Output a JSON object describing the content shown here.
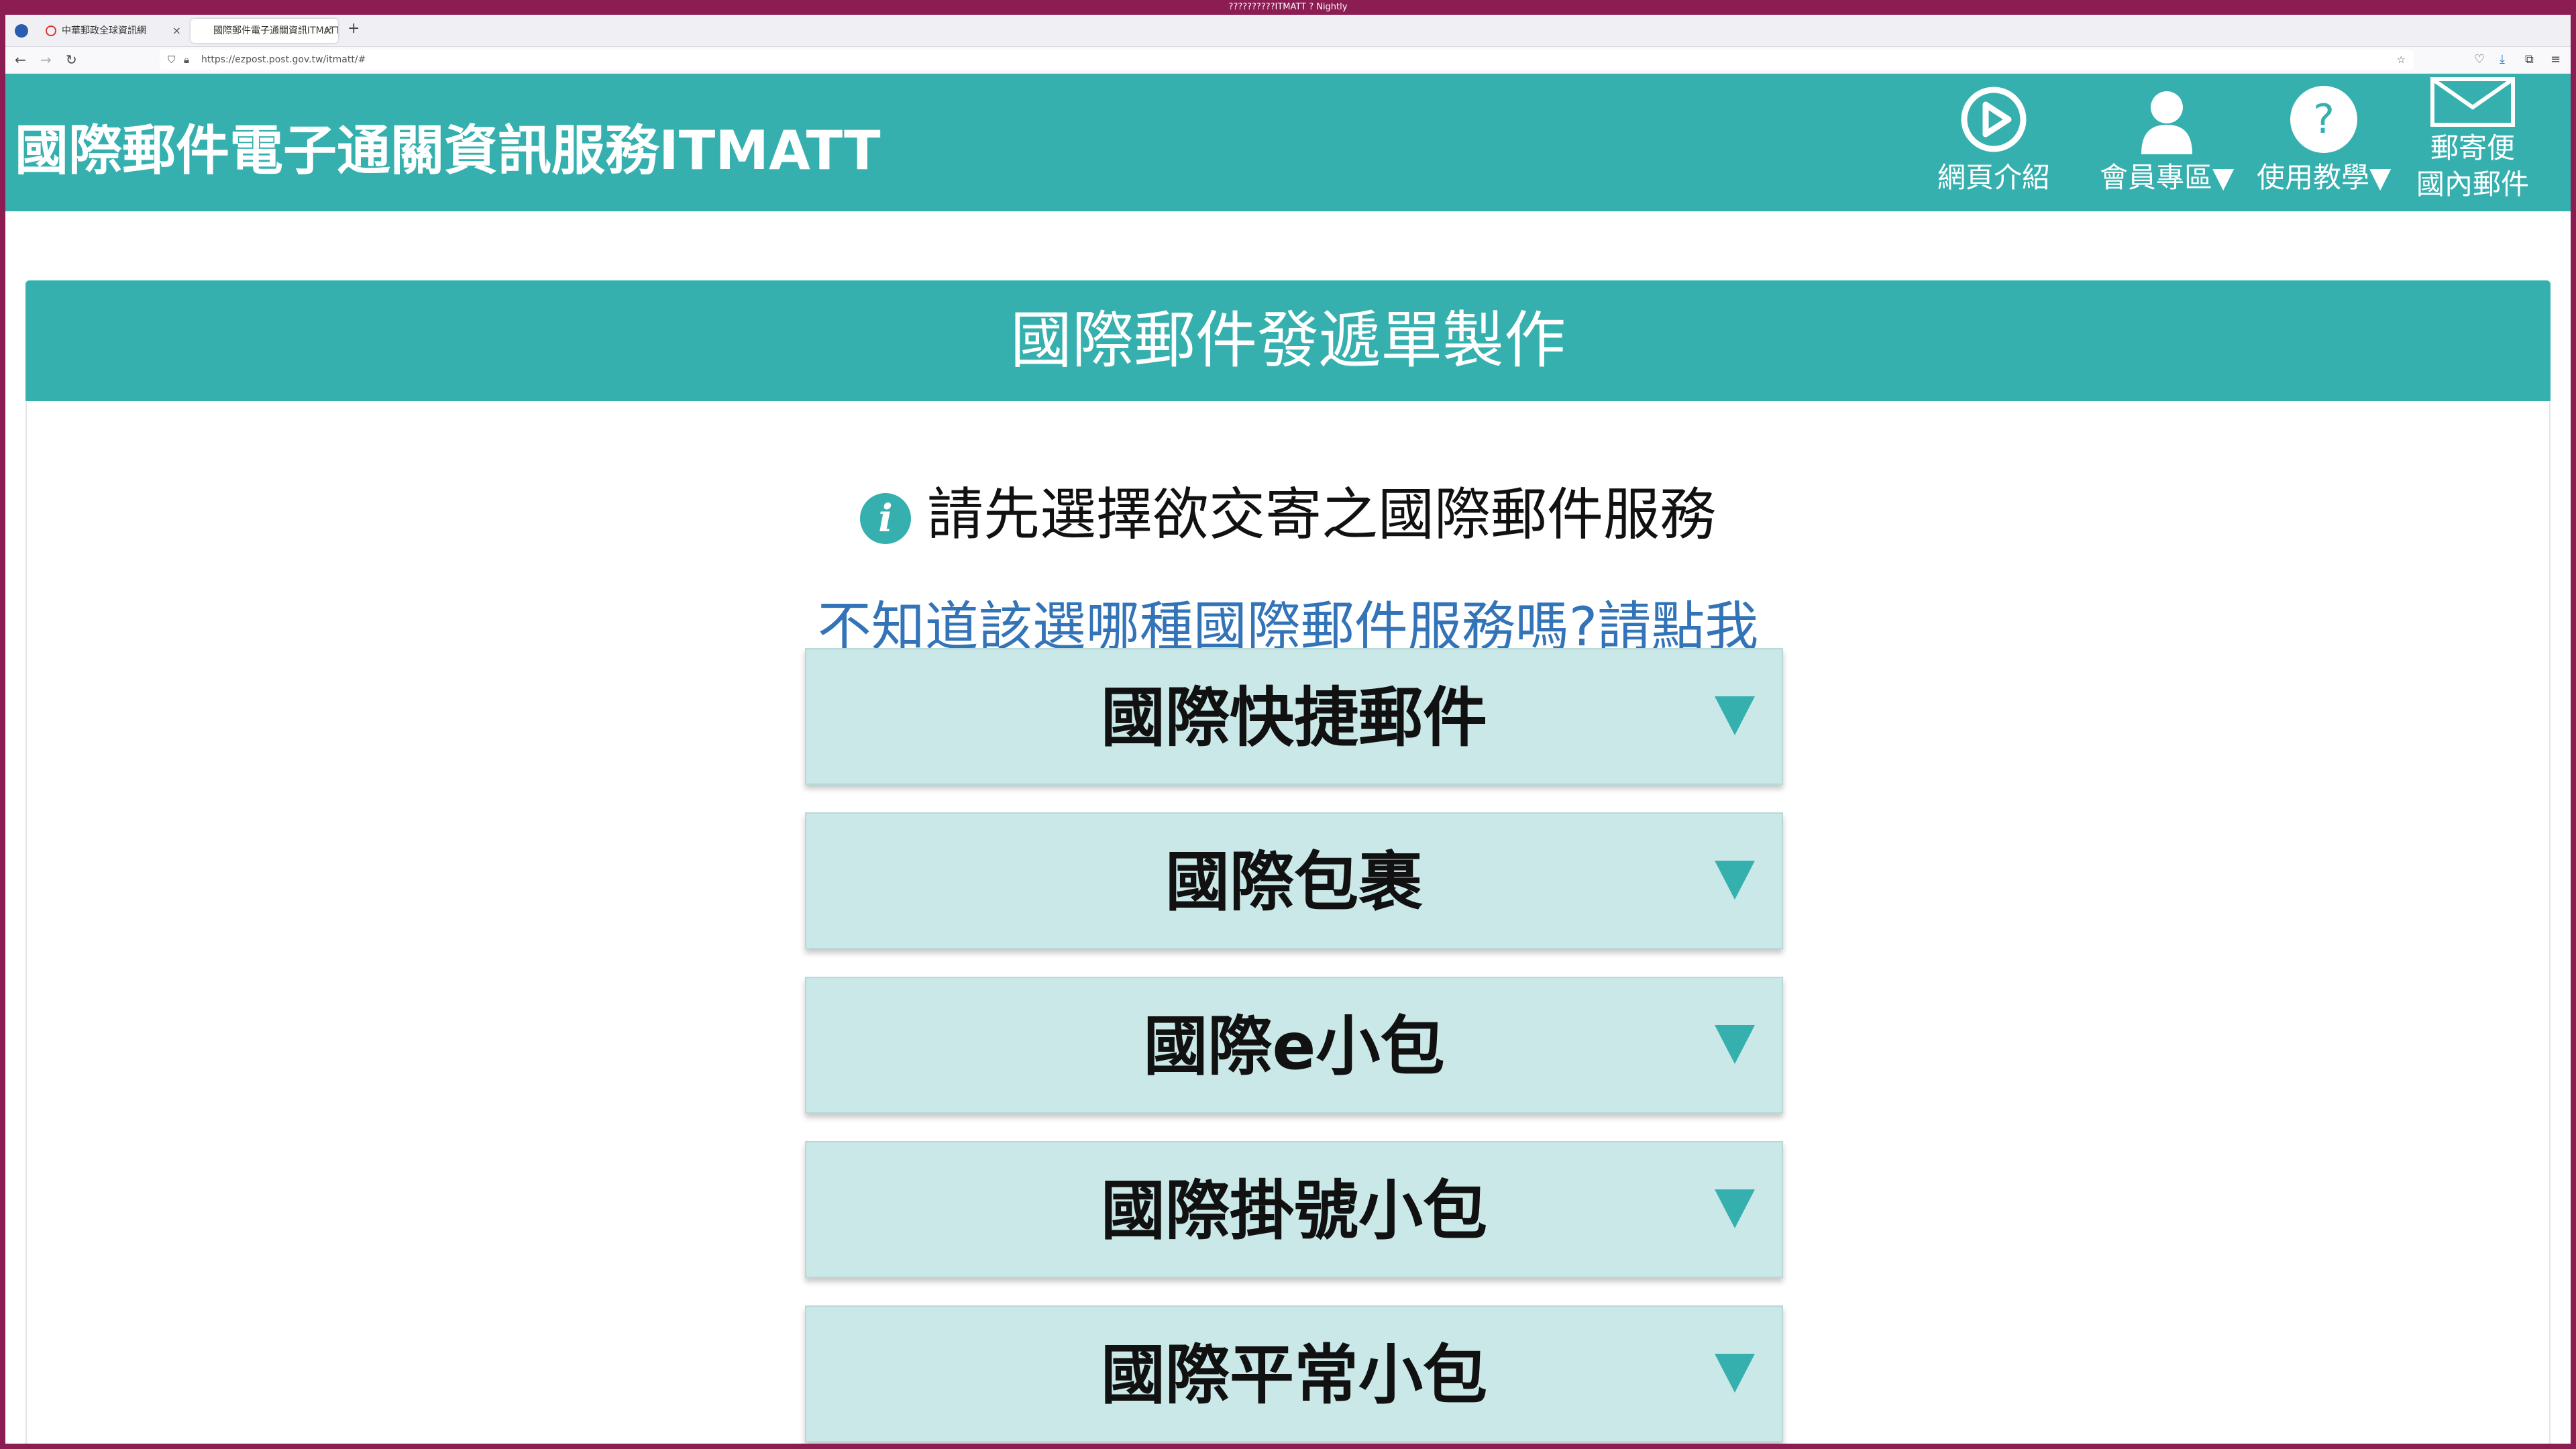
{
  "browser": {
    "window_title": "??????????ITMATT ? Nightly",
    "tabs": [
      {
        "label": "中華郵政全球資訊網",
        "active": false
      },
      {
        "label": "國際郵件電子通關資訊ITMATT",
        "active": true
      }
    ],
    "new_tab_label": "+",
    "close_label": "×",
    "url": "https://ezpost.post.gov.tw/itmatt/#"
  },
  "header": {
    "site_title": "國際郵件電子通關資訊服務ITMATT",
    "nav": [
      {
        "label": "網頁介紹",
        "icon": "play-circle-icon"
      },
      {
        "label": "會員專區▼",
        "icon": "user-icon"
      },
      {
        "label": "使用教學▼",
        "icon": "question-circle-icon"
      },
      {
        "label_line1": "郵寄便",
        "label_line2": "國內郵件",
        "icon": "envelope-icon"
      }
    ],
    "question_mark": "?"
  },
  "main": {
    "banner_title": "國際郵件發遞單製作",
    "info_glyph": "i",
    "prompt": "請先選擇欲交寄之國際郵件服務",
    "help_link": "不知道該選哪種國際郵件服務嗎?請點我",
    "services": [
      {
        "label": "國際快捷郵件"
      },
      {
        "label": "國際包裹"
      },
      {
        "label": "國際e小包"
      },
      {
        "label": "國際掛號小包"
      },
      {
        "label": "國際平常小包"
      }
    ]
  },
  "colors": {
    "teal": "#36b0ae",
    "service_bg": "#c9e8e7",
    "link_blue": "#3373b7",
    "frame": "#8b1d53"
  }
}
